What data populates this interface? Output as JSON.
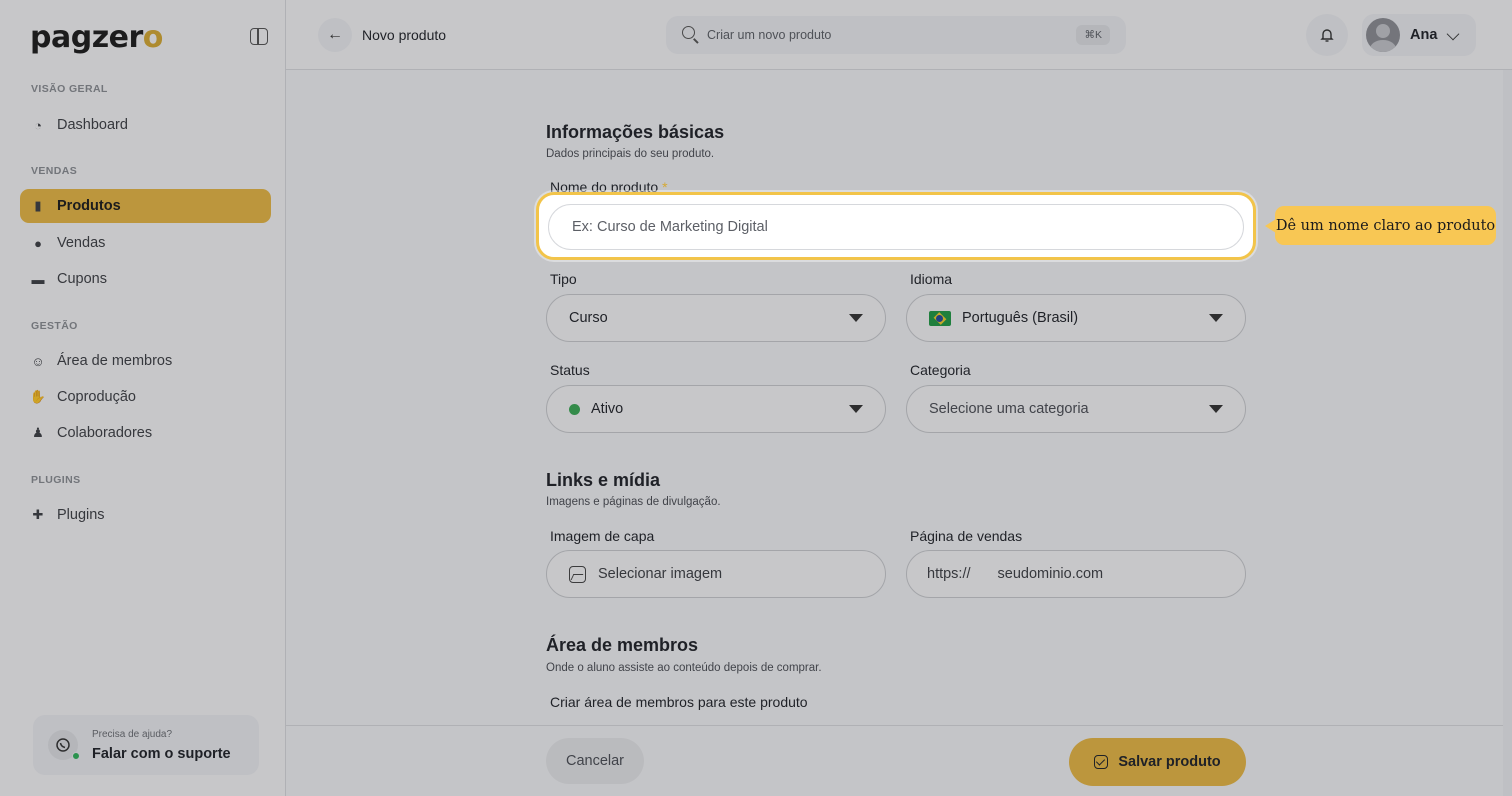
{
  "brand": {
    "logo_main": "pagzer",
    "logo_accent": "o",
    "accent_color": "#e8b845"
  },
  "sidebar": {
    "sections": [
      {
        "title": "VISÃO GERAL",
        "items": [
          {
            "label": "Dashboard",
            "icon": "chart-icon"
          }
        ]
      },
      {
        "title": "VENDAS",
        "items": [
          {
            "label": "Produtos",
            "icon": "box-icon",
            "active": true
          },
          {
            "label": "Vendas",
            "icon": "coins-icon"
          },
          {
            "label": "Cupons",
            "icon": "ticket-icon"
          }
        ]
      },
      {
        "title": "GESTÃO",
        "items": [
          {
            "label": "Área de membros",
            "icon": "users-icon"
          },
          {
            "label": "Coprodução",
            "icon": "handshake-icon"
          },
          {
            "label": "Colaboradores",
            "icon": "user-icon"
          }
        ]
      },
      {
        "title": "PLUGINS",
        "items": [
          {
            "label": "Plugins",
            "icon": "puzzle-icon"
          }
        ]
      }
    ],
    "help": {
      "question": "Precisa de ajuda?",
      "action": "Falar com o suporte"
    }
  },
  "header": {
    "title": "Novo produto",
    "search_placeholder": "Criar um novo produto",
    "shortcut": "⌘K",
    "user_name": "Ana"
  },
  "form": {
    "basic": {
      "title": "Informações básicas",
      "description": "Dados principais do seu produto."
    },
    "product_name": {
      "label": "Nome do produto",
      "required_mark": "*",
      "placeholder": "Ex: Curso de Marketing Digital"
    },
    "tipo": {
      "label": "Tipo",
      "value": "Curso"
    },
    "idioma": {
      "label": "Idioma",
      "value": "Português (Brasil)"
    },
    "status": {
      "label": "Status",
      "value": "Ativo",
      "color": "#3aaa55"
    },
    "categoria": {
      "label": "Categoria",
      "placeholder": "Selecione uma categoria"
    },
    "media": {
      "title": "Links e mídia",
      "description": "Imagens e páginas de divulgação."
    },
    "cover": {
      "label": "Imagem de capa",
      "button": "Selecionar imagem"
    },
    "sales_page": {
      "label": "Página de vendas",
      "prefix": "https://",
      "placeholder": "seudominio.com"
    },
    "members": {
      "title": "Área de membros",
      "description": "Onde o aluno assiste ao conteúdo depois de comprar.",
      "field_label": "Criar área de membros para este produto"
    }
  },
  "footer": {
    "cancel": "Cancelar",
    "save": "Salvar produto"
  },
  "tour": {
    "tooltip": "Dê um nome claro ao produto"
  }
}
